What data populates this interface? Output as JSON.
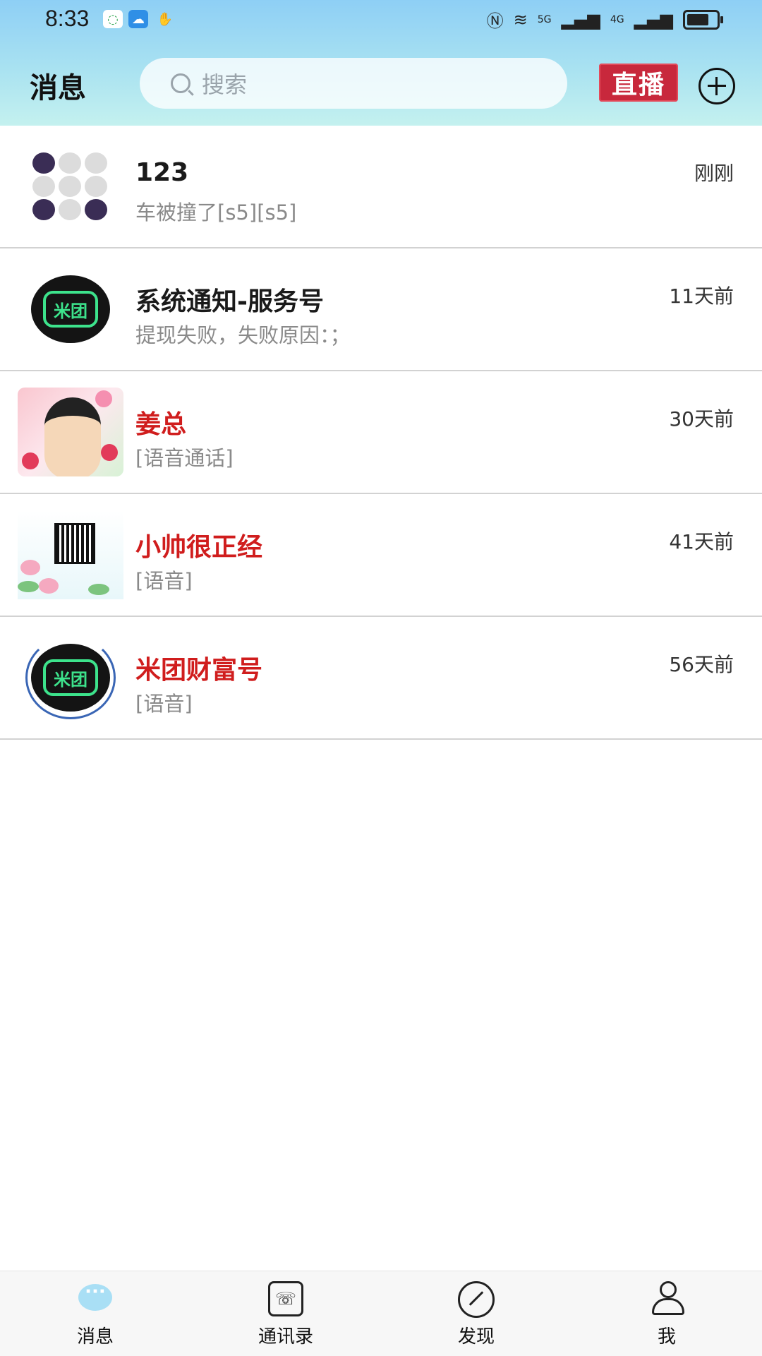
{
  "status_bar": {
    "time": "8:33",
    "network_5g": "5G",
    "network_4g": "4G"
  },
  "header": {
    "title": "消息",
    "search_placeholder": "搜索",
    "live_button": "直播"
  },
  "conversations": [
    {
      "name": "123",
      "preview": "车被撞了[s5][s5]",
      "time": "刚刚",
      "name_color": "#1a1a1a"
    },
    {
      "name": "系统通知-服务号",
      "preview": "提现失败，失败原因：；",
      "time": "11天前",
      "name_color": "#1a1a1a"
    },
    {
      "name": "姜总",
      "preview": "[语音通话]",
      "time": "30天前",
      "name_color": "#d01d1d"
    },
    {
      "name": "小帅很正经",
      "preview": "[语音]",
      "time": "41天前",
      "name_color": "#d01d1d"
    },
    {
      "name": "米团财富号",
      "preview": "[语音]",
      "time": "56天前",
      "name_color": "#d01d1d"
    }
  ],
  "logo_text": "米团",
  "bottom_nav": [
    {
      "label": "消息",
      "icon": "chat-bubble-icon",
      "active": true
    },
    {
      "label": "通讯录",
      "icon": "contacts-phone-icon",
      "active": false
    },
    {
      "label": "发现",
      "icon": "discover-compass-icon",
      "active": false
    },
    {
      "label": "我",
      "icon": "profile-person-icon",
      "active": false
    }
  ],
  "colors": {
    "header_top": "#8ecff5",
    "header_bottom": "#c4f1ef",
    "live_red": "#c8283c",
    "name_red": "#d01d1d",
    "logo_green": "#3de38c"
  }
}
